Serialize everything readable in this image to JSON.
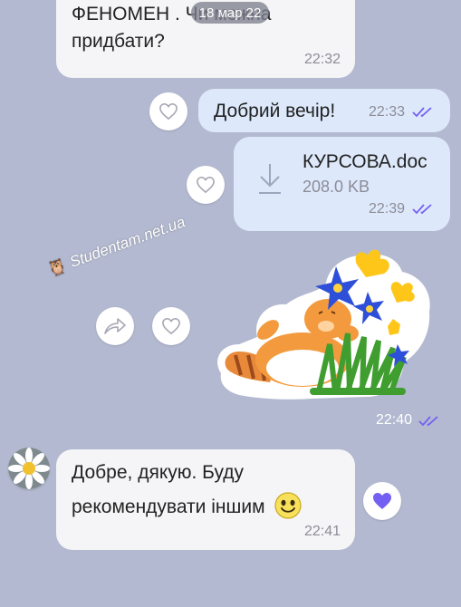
{
  "date_pill": "18 мар 22",
  "watermark": "Studentam.net.ua",
  "messages": [
    {
      "type": "incoming_text",
      "line1": "ФЕНОМЕН . Чи можна",
      "line2": "придбати?",
      "time": "22:32"
    },
    {
      "type": "outgoing_text",
      "text": "Добрий вечір!",
      "time": "22:33"
    },
    {
      "type": "outgoing_file",
      "file_name": "КУРСОВА.doc",
      "file_size": "208.0 KB",
      "time": "22:39"
    },
    {
      "type": "outgoing_sticker",
      "sticker_icon": "cat-with-flowers-sticker",
      "time": "22:40"
    },
    {
      "type": "incoming_text",
      "line1": "Добре, дякую. Буду",
      "line2": "рекомендувати іншим",
      "emoji": "smiley-emoji",
      "time": "22:41"
    }
  ],
  "icons": {
    "like": "heart-outline-icon",
    "liked": "heart-filled-icon",
    "forward": "forward-arrow-icon",
    "download": "download-icon",
    "read_receipt": "double-check-icon"
  },
  "colors": {
    "background": "#b3b9d0",
    "incoming_bubble": "#f5f5f7",
    "outgoing_bubble": "#dde9fb",
    "accent": "#7360f2"
  }
}
